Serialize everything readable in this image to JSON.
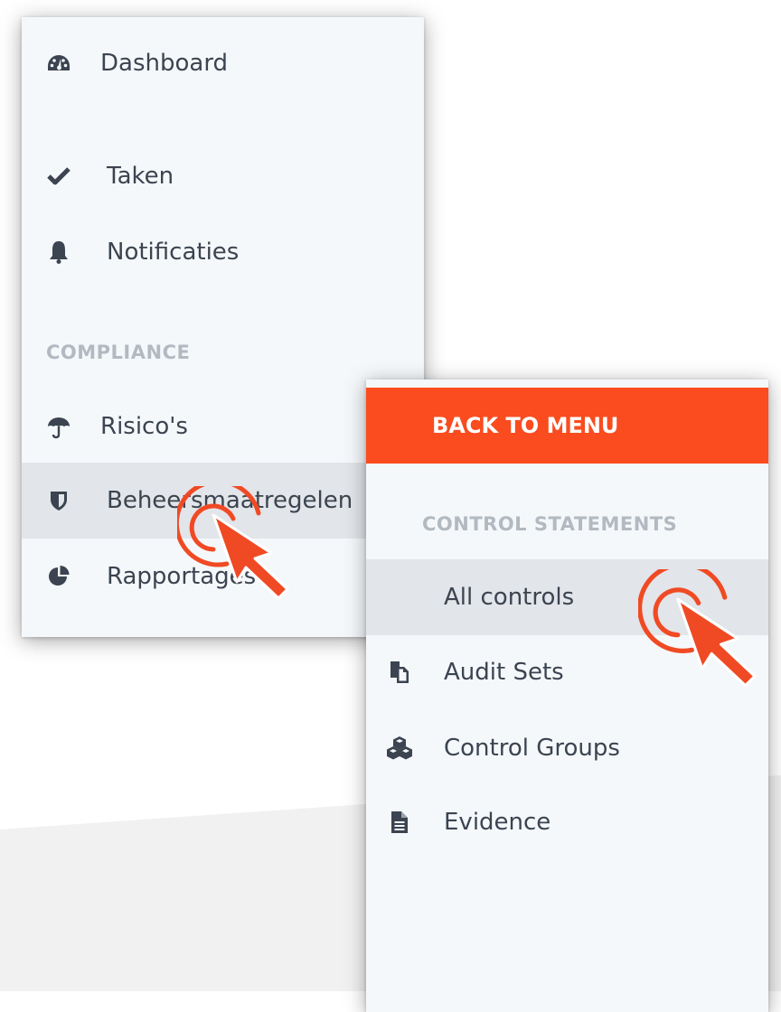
{
  "main_menu": {
    "items": [
      {
        "label": "Dashboard",
        "icon": "dashboard-icon"
      },
      {
        "label": "Taken",
        "icon": "check-icon"
      },
      {
        "label": "Notificaties",
        "icon": "bell-icon"
      }
    ],
    "section": "COMPLIANCE",
    "compliance_items": [
      {
        "label": "Risico's",
        "icon": "umbrella-icon"
      },
      {
        "label": "Beheersmaatregelen",
        "icon": "shield-icon",
        "chevron": ">",
        "active": true
      },
      {
        "label": "Rapportages",
        "icon": "pie-chart-icon",
        "chevron": ">"
      }
    ]
  },
  "sub_menu": {
    "back_label": "BACK TO MENU",
    "section": "CONTROL STATEMENTS",
    "items": [
      {
        "label": "All controls",
        "active": true
      },
      {
        "label": "Audit Sets",
        "icon": "copy-icon"
      },
      {
        "label": "Control Groups",
        "icon": "cubes-icon"
      },
      {
        "label": "Evidence",
        "icon": "document-icon"
      }
    ]
  },
  "colors": {
    "accent": "#fa4c1f",
    "panel_bg": "#f5f8fb",
    "active_bg": "#e2e5e9",
    "text": "#3b4450",
    "section_text": "#b2b9c0"
  }
}
